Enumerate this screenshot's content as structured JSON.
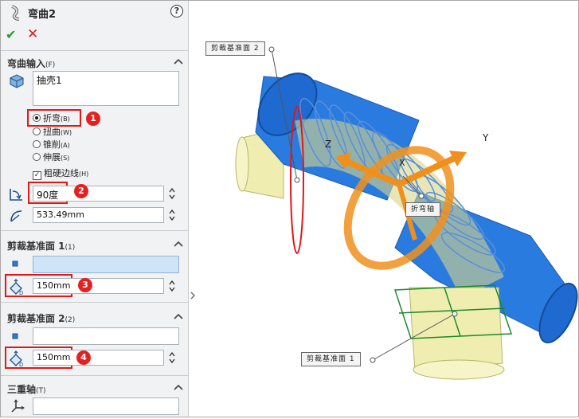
{
  "feature": {
    "title": "弯曲2",
    "help": "?"
  },
  "actions": {
    "ok": "✔",
    "cancel": "✕"
  },
  "flex_input": {
    "header": "弯曲输入",
    "header_shortcut": "(F)",
    "selection": "抽壳1",
    "options": [
      {
        "label": "折弯",
        "key": "(B)",
        "checked": true
      },
      {
        "label": "扭曲",
        "key": "(W)",
        "checked": false
      },
      {
        "label": "锥削",
        "key": "(A)",
        "checked": false
      },
      {
        "label": "伸展",
        "key": "(S)",
        "checked": false
      }
    ],
    "hard_edges": {
      "label": "粗硬边线",
      "key": "(H)",
      "checked": true
    },
    "angle": "90度",
    "radius": "533.49mm"
  },
  "trim_plane_1": {
    "header": "剪裁基准面 1",
    "count": "(1)",
    "distance": "150mm"
  },
  "trim_plane_2": {
    "header": "剪裁基准面 2",
    "count": "(2)",
    "distance": "150mm"
  },
  "triad": {
    "header": "三重轴",
    "shortcut": "(T)"
  },
  "badges": [
    "1",
    "2",
    "3",
    "4"
  ],
  "viewport": {
    "callout_plane2": "剪裁基准面 2",
    "callout_axis": "折弯轴",
    "callout_plane1": "剪裁基准面 1",
    "axis_y": "Y",
    "axis_z": "Z",
    "axis_x": "X"
  },
  "colors": {
    "accent_red": "#e01818",
    "pipe_blue": "#2a7be0",
    "pipe_yellow": "#efeeb0",
    "triad_orange": "#f0901c",
    "plane_green": "#1a8a2a"
  }
}
